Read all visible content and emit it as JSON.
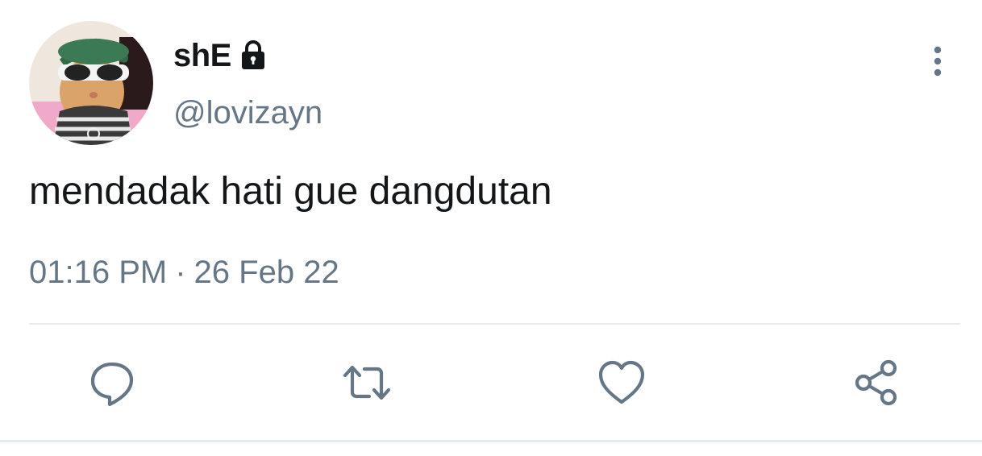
{
  "tweet": {
    "display_name": "shE",
    "handle": "@lovizayn",
    "text": "mendadak hati gue dangdutan",
    "time": "01:16 PM",
    "separator": "·",
    "date": "26 Feb 22",
    "protected_icon": "lock-icon",
    "avatar_description": "cat-with-sunglasses-avatar"
  },
  "actions": {
    "reply_icon": "reply-icon",
    "retweet_icon": "retweet-icon",
    "like_icon": "heart-icon",
    "share_icon": "share-icon",
    "more_icon": "more-vertical-icon"
  },
  "colors": {
    "text_primary": "#14171a",
    "text_secondary": "#657786",
    "divider": "#e6ecf0",
    "icon": "#657786"
  }
}
